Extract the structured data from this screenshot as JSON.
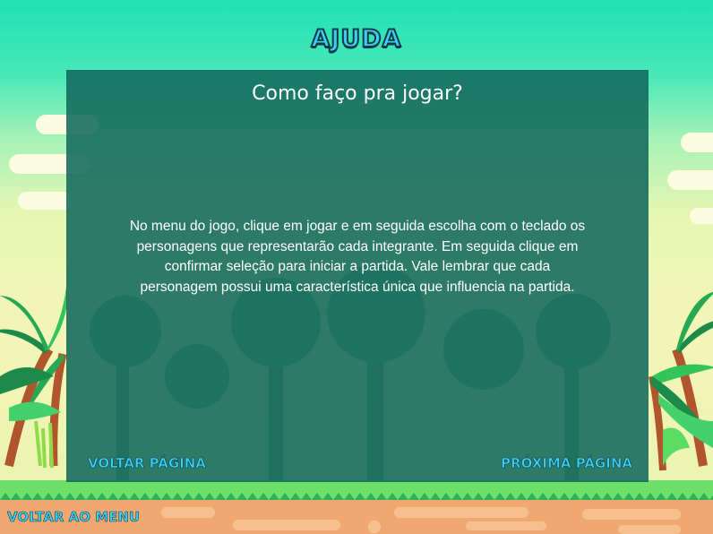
{
  "screen": {
    "title": "AJUDA",
    "question": "Como faço pra jogar?",
    "answer": "No menu do jogo, clique em jogar e em seguida escolha com o teclado os personagens que representarão cada integrante. Em seguida clique em confirmar seleção para iniciar a partida. Vale lembrar que cada personagem possui uma característica única que influencia na partida."
  },
  "buttons": {
    "prev_label": "VOLTAR PÁGINA",
    "next_label": "PRÓXIMA PÁGINA",
    "menu_label": "VOLTAR AO MENU"
  },
  "colors": {
    "sky_top": "#1fe0b4",
    "panel": "#12695c",
    "button_text": "#3ad0f5",
    "grass": "#6ee06a",
    "ground": "#f0a870"
  }
}
